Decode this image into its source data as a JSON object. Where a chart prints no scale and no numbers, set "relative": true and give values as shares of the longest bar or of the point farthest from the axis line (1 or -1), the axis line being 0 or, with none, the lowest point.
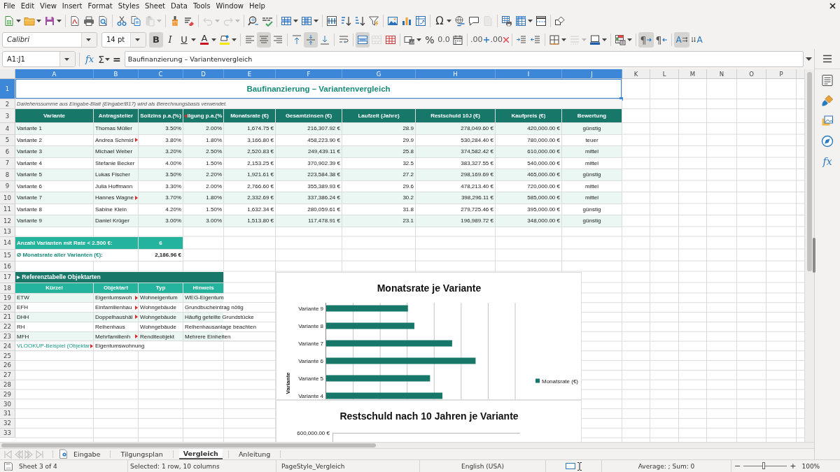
{
  "menu": [
    "File",
    "Edit",
    "View",
    "Insert",
    "Format",
    "Styles",
    "Sheet",
    "Data",
    "Tools",
    "Window",
    "Help"
  ],
  "standard_toolbar": {
    "paste": {
      "enabled": false
    },
    "undo": {
      "enabled": false
    },
    "redo": {
      "enabled": false
    },
    "special_character": {
      "label": "Ω"
    },
    "header_footer": {
      "enabled": false
    }
  },
  "format_toolbar": {
    "font_name": "Calibri",
    "font_size": "14 pt",
    "bold": {
      "label": "B",
      "on": true
    },
    "italic": {
      "label": "I",
      "on": false
    },
    "underline": {
      "label": "U",
      "on": false
    },
    "font_color": {
      "label": "A"
    },
    "align_left": {
      "on": false
    },
    "align_center": {
      "on": true
    },
    "align_right": {
      "on": false
    },
    "align_top": {
      "on": false
    },
    "align_middle": {
      "on": true
    },
    "align_bottom": {
      "on": false
    },
    "wrap_text": {
      "on": false
    },
    "merge_center": {
      "on": true
    },
    "merge_cells": {
      "enabled": false
    },
    "percent": {
      "label": "%"
    },
    "number": {
      "label": "0.0"
    },
    "add_decimal": {
      "label": ".00"
    },
    "delete_decimal": {
      "label": ".00"
    },
    "border_style": {
      "enabled": false
    },
    "ltr": {
      "label": "¶",
      "on": true
    },
    "rtl": {
      "label": "¶",
      "on": false
    },
    "text_ltr": {
      "label": "A",
      "on": true
    },
    "text_ttb": {
      "label": "A",
      "on": false
    }
  },
  "formula_bar": {
    "name_box": "A1:J1",
    "function_wizard": "fx",
    "sum": "Σ",
    "equals": "=",
    "content": "Baufinanzierung – Variantenvergleich"
  },
  "sidebar": {
    "functions": "fx"
  },
  "sheet": {
    "columns": [
      {
        "label": "A",
        "selected": true
      },
      {
        "label": "B",
        "selected": true
      },
      {
        "label": "C",
        "selected": true
      },
      {
        "label": "D",
        "selected": true
      },
      {
        "label": "E",
        "selected": true
      },
      {
        "label": "F",
        "selected": true
      },
      {
        "label": "G",
        "selected": true
      },
      {
        "label": "H",
        "selected": true
      },
      {
        "label": "I",
        "selected": true
      },
      {
        "label": "J",
        "selected": true
      },
      {
        "label": "K",
        "selected": false
      },
      {
        "label": "L",
        "selected": false
      },
      {
        "label": "M",
        "selected": false
      },
      {
        "label": "N",
        "selected": false
      },
      {
        "label": "O",
        "selected": false
      },
      {
        "label": "P",
        "selected": false
      }
    ],
    "rows": [
      {
        "label": "1",
        "selected": true
      },
      {
        "label": "2",
        "selected": false
      },
      {
        "label": "3",
        "selected": false
      },
      {
        "label": "4",
        "selected": false
      },
      {
        "label": "5",
        "selected": false
      },
      {
        "label": "6",
        "selected": false
      },
      {
        "label": "7",
        "selected": false
      },
      {
        "label": "8",
        "selected": false
      },
      {
        "label": "9",
        "selected": false
      },
      {
        "label": "10",
        "selected": false
      },
      {
        "label": "11",
        "selected": false
      },
      {
        "label": "12",
        "selected": false
      },
      {
        "label": "13",
        "selected": false
      },
      {
        "label": "14",
        "selected": false
      },
      {
        "label": "15",
        "selected": false
      },
      {
        "label": "16",
        "selected": false
      },
      {
        "label": "17",
        "selected": false
      },
      {
        "label": "18",
        "selected": false
      },
      {
        "label": "19",
        "selected": false
      },
      {
        "label": "20",
        "selected": false
      },
      {
        "label": "21",
        "selected": false
      },
      {
        "label": "22",
        "selected": false
      },
      {
        "label": "23",
        "selected": false
      },
      {
        "label": "24",
        "selected": false
      },
      {
        "label": "25",
        "selected": false
      },
      {
        "label": "26",
        "selected": false
      },
      {
        "label": "27",
        "selected": false
      },
      {
        "label": "28",
        "selected": false
      },
      {
        "label": "29",
        "selected": false
      },
      {
        "label": "30",
        "selected": false
      },
      {
        "label": "31",
        "selected": false
      },
      {
        "label": "32",
        "selected": false
      },
      {
        "label": "33",
        "selected": false
      }
    ],
    "title": "Baufinanzierung – Variantenvergleich",
    "title_selected": true,
    "note": "Darlehenssumme aus Eingabe-Blatt (Eingabe!B17) wird als Berechnungsbasis verwendet.",
    "comparison": {
      "headers": [
        "Variante",
        "Antragsteller",
        "Sollzins p.a.(%)",
        {
          "text": "ilgung p.a.(%",
          "clipped": true
        },
        "Monatsrate (€)",
        "Gesamtzinsen (€)",
        "Laufzeit (Jahre)",
        "Restschuld 10J (€)",
        "Kaufpreis (€)",
        "Bewertung"
      ],
      "rows": [
        {
          "shaded": true,
          "cells": [
            "Variante 1",
            "Thomas Müller",
            "3.50%",
            "2.00%",
            "1,674.75 €",
            "216,307.92 €",
            "28.9",
            "278,049.60 €",
            "420,000.00 €",
            "günstig"
          ]
        },
        {
          "shaded": false,
          "cells": [
            "Variante 2",
            {
              "text": "Andrea Schmid",
              "clipped": true
            },
            "3.80%",
            "1.80%",
            "3,166.80 €",
            "458,223.90 €",
            "29.9",
            "530,284.40 €",
            "780,000.00 €",
            "teuer"
          ]
        },
        {
          "shaded": true,
          "cells": [
            "Variante 3",
            "Michael Weber",
            "3.20%",
            "2.50%",
            "2,520.83 €",
            "249,439.11 €",
            "25.8",
            "374,582.42 €",
            "610,000.00 €",
            "mittel"
          ]
        },
        {
          "shaded": false,
          "cells": [
            "Variante 4",
            "Stefanie Becker",
            "4.00%",
            "1.50%",
            "2,153.25 €",
            "370,902.39 €",
            "32.5",
            "383,327.55 €",
            "540,000.00 €",
            "mittel"
          ]
        },
        {
          "shaded": true,
          "cells": [
            "Variante 5",
            "Lukas Fischer",
            "3.50%",
            "2.20%",
            "1,921.61 €",
            "223,584.38 €",
            "27.2",
            "298,169.69 €",
            "465,000.00 €",
            "günstig"
          ]
        },
        {
          "shaded": false,
          "cells": [
            "Variante 6",
            "Julia Hoffmann",
            "3.30%",
            "2.00%",
            "2,766.60 €",
            "355,389.93 €",
            "29.6",
            "478,213.40 €",
            "720,000.00 €",
            "mittel"
          ]
        },
        {
          "shaded": true,
          "cells": [
            "Variante 7",
            {
              "text": "Hannes Wagne",
              "clipped": true
            },
            "3.70%",
            "1.80%",
            "2,332.69 €",
            "337,386.24 €",
            "30.2",
            "398,296.11 €",
            "585,000.00 €",
            "mittel"
          ]
        },
        {
          "shaded": false,
          "cells": [
            "Variante 8",
            "Sabine Klein",
            "4.20%",
            "1.50%",
            "1,632.34 €",
            "280,059.61 €",
            "31.8",
            "279,725.46 €",
            "395,000.00 €",
            "günstig"
          ]
        },
        {
          "shaded": true,
          "cells": [
            "Variante 9",
            "Daniel Krüger",
            "3.00%",
            "3.00%",
            "1,513.80 €",
            "117,478.91 €",
            "23.1",
            "196,989.72 €",
            "348,000.00 €",
            "günstig"
          ]
        }
      ]
    },
    "summary": [
      {
        "kind": "highlight",
        "label": "Anzahl Varianten mit Rate < 2.500 €:",
        "value": "6"
      },
      {
        "kind": "plain",
        "label": "Ø Monatsrate aller Varianten (€):",
        "value": "2,186.96 €"
      }
    ],
    "reference": {
      "title": "▸ Referenztabelle Objektarten",
      "headers": [
        "Kürzel",
        "Objektart",
        "Typ",
        "Hinweis"
      ],
      "rows": [
        {
          "shaded": true,
          "cells": [
            "ETW",
            {
              "text": "Eigentumswoh",
              "clipped": true
            },
            "Wohneigentum",
            "WEG-Eigentum"
          ]
        },
        {
          "shaded": false,
          "cells": [
            "EFH",
            {
              "text": "Einfamilienhau",
              "clipped": true
            },
            "Wohngebäude",
            "Grundbucheintrag nötig"
          ]
        },
        {
          "shaded": true,
          "cells": [
            "DHH",
            {
              "text": "Doppelhaushäl",
              "clipped": true
            },
            "Wohngebäude",
            "Häufig geteilte Grundstücke"
          ]
        },
        {
          "shaded": false,
          "cells": [
            "RH",
            "Reihenhaus",
            "Wohngebäude",
            "Reihenhausanlage beachten"
          ]
        },
        {
          "shaded": true,
          "cells": [
            "MFH",
            {
              "text": "Mehrfamilienh",
              "clipped": true
            },
            "Renditeobjekt",
            "Mehrere Einheiten"
          ]
        }
      ]
    },
    "lookup_example": {
      "label": {
        "text": "VLOOKUP-Beispiel (Objektar",
        "clipped": true
      },
      "value": "Eigentumswohnung"
    },
    "charts": [
      {
        "chart_data": {
          "type": "bar",
          "orientation": "horizontal",
          "title": "Monatsrate je Variante",
          "ylabel": "Variante",
          "categories": [
            "Variante 9",
            "Variante 8",
            "Variante 7",
            "Variante 6",
            "Variante 5",
            "Variante 4"
          ],
          "series": [
            {
              "name": "Monatsrate (€)",
              "color": "#17786a",
              "values": [
                0.547,
                0.59,
                0.843,
                1,
                0.695,
                0.778
              ]
            }
          ],
          "relative": true
        }
      },
      {
        "title": "Restschuld nach 10 Jahren je Variante",
        "axis_value_label": "600,000.00 €"
      }
    ]
  },
  "sheet_navigation": {
    "enabled": false
  },
  "sheet_tabs": [
    {
      "label": "Eingabe",
      "selected": false
    },
    {
      "label": "Tilgungsplan",
      "selected": false
    },
    {
      "label": "Vergleich",
      "selected": true
    },
    {
      "label": "Anleitung",
      "selected": false
    }
  ],
  "status_bar": {
    "sheet": "Sheet 3 of 4",
    "selection": "Selected: 1 row, 10 columns",
    "page_style": "PageStyle_Vergleich",
    "language": "English (USA)",
    "summary": "Average: ; Sum: 0",
    "zoom_out": "−",
    "zoom_slider": {
      "level": 0.47
    },
    "zoom_in": "+",
    "zoom_percent": "100%"
  }
}
